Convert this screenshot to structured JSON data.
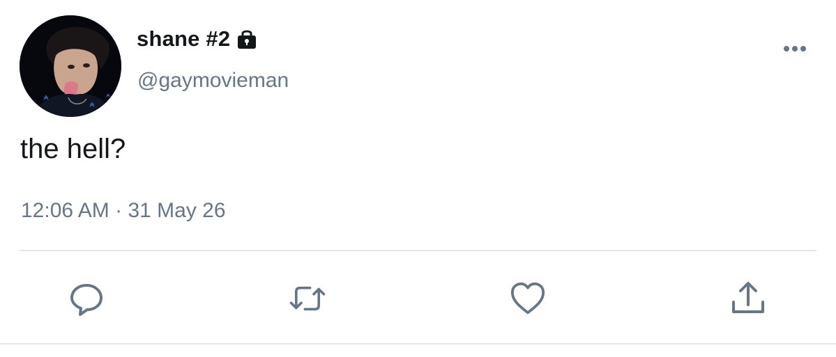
{
  "author": {
    "display_name": "shane #2",
    "handle": "@gaymovieman",
    "protected_icon": "lock-icon",
    "avatar": "avatar"
  },
  "menu_icon": "more-horizontal-icon",
  "tweet": {
    "text": "the hell?",
    "time": "12:06 AM",
    "separator": "·",
    "date": "31 May 26"
  },
  "actions": [
    {
      "name": "reply",
      "icon": "reply-icon"
    },
    {
      "name": "retweet",
      "icon": "retweet-icon"
    },
    {
      "name": "like",
      "icon": "heart-icon"
    },
    {
      "name": "share",
      "icon": "share-icon"
    }
  ],
  "colors": {
    "primary_text": "#14171a",
    "secondary_text": "#657786",
    "icon": "#657786",
    "divider": "#e1e8ed"
  }
}
